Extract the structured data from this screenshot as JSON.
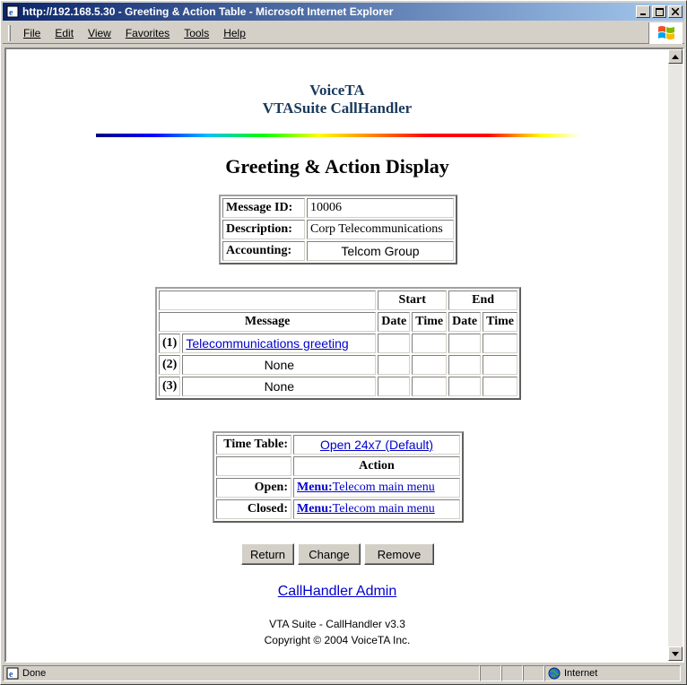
{
  "window": {
    "title": "http://192.168.5.30 - Greeting & Action Table - Microsoft Internet Explorer"
  },
  "menu": [
    "File",
    "Edit",
    "View",
    "Favorites",
    "Tools",
    "Help"
  ],
  "header": {
    "line1": "VoiceTA",
    "line2": "VTASuite CallHandler"
  },
  "page_title": "Greeting & Action Display",
  "message_info": {
    "id_label": "Message ID:",
    "id_value": "10006",
    "desc_label": "Description:",
    "desc_value": "Corp Telecommunications",
    "acct_label": "Accounting:",
    "acct_value": "Telcom Group"
  },
  "messages_table": {
    "start_header": "Start",
    "end_header": "End",
    "message_header": "Message",
    "date_header": "Date",
    "time_header": "Time",
    "rows": [
      {
        "index": "(1)",
        "message": "Telecommunications greeting"
      },
      {
        "index": "(2)",
        "message": "None"
      },
      {
        "index": "(3)",
        "message": "None"
      }
    ]
  },
  "timetable": {
    "label": "Time Table:",
    "value": "Open 24x7 (Default)",
    "action_header": "Action",
    "open_label": "Open:",
    "open_action_type": "Menu:",
    "open_action_value": "Telecom main menu",
    "closed_label": "Closed:",
    "closed_action_type": "Menu:",
    "closed_action_value": "Telecom main menu"
  },
  "buttons": {
    "return": "Return",
    "change": "Change",
    "remove": "Remove"
  },
  "admin_link": "CallHandler Admin",
  "footer": {
    "line1": "VTA Suite - CallHandler v3.3",
    "line2": "Copyright © 2004 VoiceTA Inc."
  },
  "status": {
    "text": "Done",
    "zone": "Internet"
  }
}
